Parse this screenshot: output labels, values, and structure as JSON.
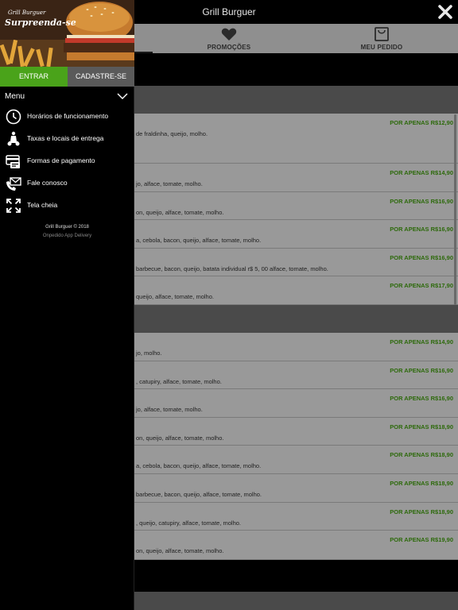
{
  "header": {
    "title": "Grill Burguer"
  },
  "tabs": [
    {
      "label": ""
    },
    {
      "label": "PROMOÇÕES",
      "icon": "heart-icon"
    },
    {
      "label": "MEU PEDIDO",
      "icon": "bag-icon"
    }
  ],
  "drawer": {
    "brand": "Grill Burguer",
    "slogan": "Surpreenda-se",
    "login_label": "ENTRAR",
    "register_label": "CADASTRE-SE",
    "menu_title": "Menu",
    "items": [
      {
        "label": "Horários de funcionamento",
        "icon": "clock-icon"
      },
      {
        "label": "Taxas e locais de entrega",
        "icon": "scooter-icon"
      },
      {
        "label": "Formas de pagamento",
        "icon": "card-payment-icon"
      },
      {
        "label": "Fale conosco",
        "icon": "phone-mail-icon"
      },
      {
        "label": "Tela cheia",
        "icon": "fullscreen-icon"
      }
    ],
    "footer_copyright": "Grill Burguer © 2018",
    "footer_powered": "Onpedido App Delivery"
  },
  "menu_items": [
    {
      "price": "POR APENAS R$12,90",
      "desc": "de fraldinha, queijo, molho."
    },
    {
      "price": "POR APENAS R$14,90",
      "desc": "jo, alface, tomate, molho."
    },
    {
      "price": "POR APENAS R$16,90",
      "desc": "on, queijo, alface, tomate, molho."
    },
    {
      "price": "POR APENAS R$16,90",
      "desc": "a, cebola, bacon, queijo, alface, tomate, molho."
    },
    {
      "price": "POR APENAS R$16,90",
      "desc": "barbecue, bacon, queijo, batata individual r$ 5, 00 alface, tomate, molho."
    },
    {
      "price": "POR APENAS R$17,90",
      "desc": "queijo, alface, tomate, molho."
    },
    {
      "price": "POR APENAS R$14,90",
      "desc": "jo, molho."
    },
    {
      "price": "POR APENAS R$16,90",
      "desc": ", catupiry, alface, tomate, molho."
    },
    {
      "price": "POR APENAS R$16,90",
      "desc": "jo, alface, tomate, molho."
    },
    {
      "price": "POR APENAS R$18,90",
      "desc": "on, queijo, alface, tomate, molho."
    },
    {
      "price": "POR APENAS R$18,90",
      "desc": "a, cebola, bacon, queijo, alface, tomate, molho."
    },
    {
      "price": "POR APENAS R$18,90",
      "desc": "barbecue, bacon, queijo, alface, tomate, molho."
    },
    {
      "price": "POR APENAS R$18,90",
      "desc": ", queijo, catupiry, alface, tomate, molho."
    },
    {
      "price": "POR APENAS R$19,90",
      "desc": "on, queijo, alface, tomate, molho."
    }
  ],
  "colors": {
    "accent_green": "#4aa31a",
    "price_green": "#2d6a0b"
  }
}
